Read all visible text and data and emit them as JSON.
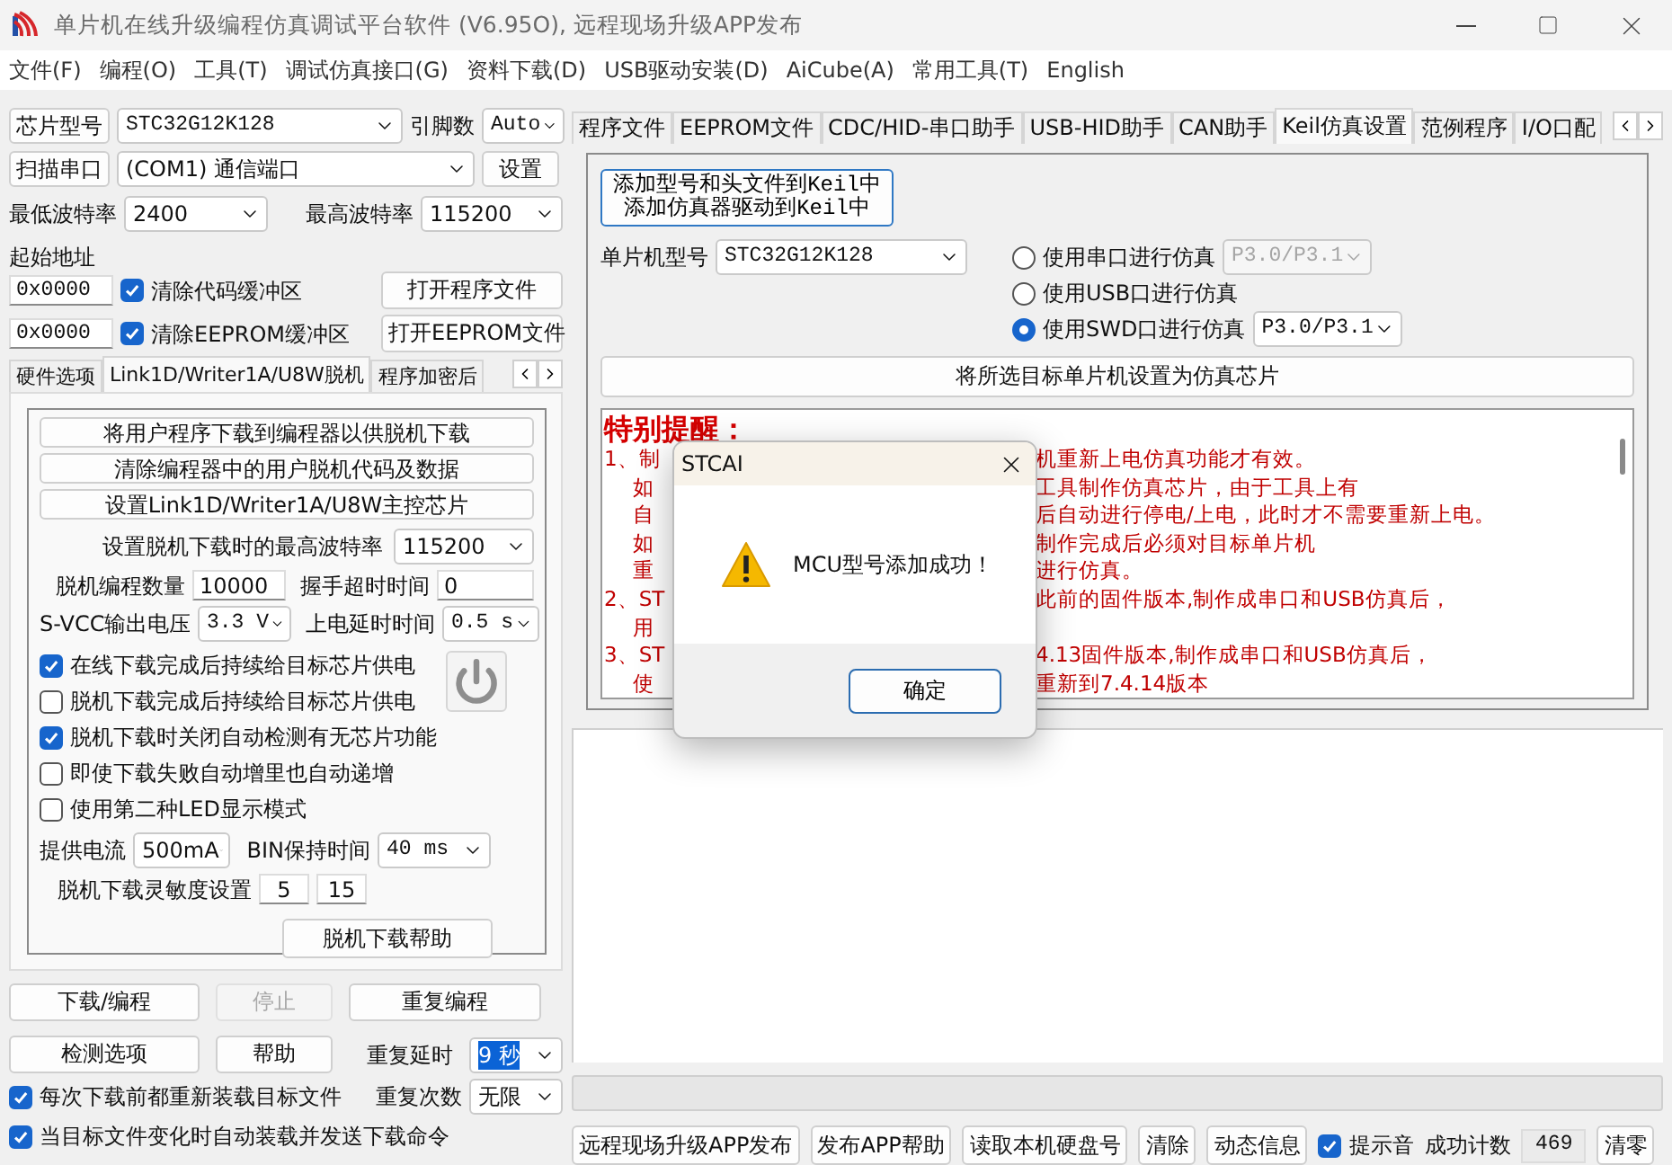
{
  "window": {
    "title": "单片机在线升级编程仿真调试平台软件 (V6.95O), 远程现场升级APP发布"
  },
  "menu": [
    "文件(F)",
    "编程(O)",
    "工具(T)",
    "调试仿真接口(G)",
    "资料下载(D)",
    "USB驱动安装(D)",
    "AiCube(A)",
    "常用工具(T)",
    "English"
  ],
  "chip": {
    "button": "芯片型号",
    "value": "STC32G12K128",
    "pins_label": "引脚数",
    "pins_value": "Auto"
  },
  "port": {
    "button": "扫描串口",
    "value": "(COM1) 通信端口",
    "settings": "设置"
  },
  "baud": {
    "min_label": "最低波特率",
    "min_value": "2400",
    "max_label": "最高波特率",
    "max_value": "115200"
  },
  "start_address": {
    "label": "起始地址",
    "rows": [
      {
        "value": "0x0000",
        "option": "清除代码缓冲区",
        "checked": true,
        "button": "打开程序文件"
      },
      {
        "value": "0x0000",
        "option": "清除EEPROM缓冲区",
        "checked": true,
        "button": "打开EEPROM文件"
      }
    ]
  },
  "left_tabs": [
    {
      "label": "硬件选项",
      "selected": false
    },
    {
      "label": "Link1D/Writer1A/U8W脱机",
      "selected": true
    },
    {
      "label": "程序加密后",
      "selected": false
    }
  ],
  "offline": {
    "actions": [
      "将用户程序下载到编程器以供脱机下载",
      "清除编程器中的用户脱机代码及数据",
      "设置Link1D/Writer1A/U8W主控芯片"
    ],
    "max_baud_label": "设置脱机下载时的最高波特率",
    "max_baud_value": "115200",
    "count_label": "脱机编程数量",
    "count_value": "10000",
    "handshake_label": "握手超时时间",
    "handshake_value": "0",
    "vcc_label": "S-VCC输出电压",
    "vcc_value": "3.3 V",
    "delay_label": "上电延时时间",
    "delay_value": "0.5 s",
    "options": [
      {
        "label": "在线下载完成后持续给目标芯片供电",
        "checked": true
      },
      {
        "label": "脱机下载完成后持续给目标芯片供电",
        "checked": false
      },
      {
        "label": "脱机下载时关闭自动检测有无芯片功能",
        "checked": true
      },
      {
        "label": "即使下载失败自动增里也自动递增",
        "checked": false
      },
      {
        "label": "使用第二种LED显示模式",
        "checked": false
      }
    ],
    "current_label": "提供电流",
    "current_value": "500mA",
    "bin_label": "BIN保持时间",
    "bin_value": "40 ms",
    "sensitivity_label": "脱机下载灵敏度设置",
    "sensitivity_values": [
      "5",
      "15"
    ],
    "help": "脱机下载帮助"
  },
  "actions": [
    {
      "label": "下载/编程",
      "disabled": false
    },
    {
      "label": "停止",
      "disabled": true
    },
    {
      "label": "重复编程",
      "disabled": false
    }
  ],
  "detect": "检测选项",
  "help": "帮助",
  "repeat_delay": {
    "label": "重复延时",
    "value": "9 秒",
    "highlighted": true
  },
  "repeat_count": {
    "label": "重复次数",
    "value": "无限"
  },
  "reload_options": [
    {
      "label": "每次下载前都重新装载目标文件",
      "checked": true
    },
    {
      "label": "当目标文件变化时自动装载并发送下载命令",
      "checked": true
    }
  ],
  "right_tabs": [
    {
      "label": "程序文件",
      "selected": false
    },
    {
      "label": "EEPROM文件",
      "selected": false
    },
    {
      "label": "CDC/HID-串口助手",
      "selected": false
    },
    {
      "label": "USB-HID助手",
      "selected": false
    },
    {
      "label": "CAN助手",
      "selected": false
    },
    {
      "label": "Keil仿真设置",
      "selected": true
    },
    {
      "label": "范例程序",
      "selected": false
    },
    {
      "label": "I/O口配",
      "selected": false
    }
  ],
  "keil": {
    "add_button": [
      "添加型号和头文件到Keil中",
      "添加仿真器驱动到Keil中"
    ],
    "mcu_label": "单片机型号",
    "mcu_value": "STC32G12K128",
    "modes": [
      {
        "label": "使用串口进行仿真",
        "selected": false,
        "port": "P3.0/P3.1",
        "port_disabled": true
      },
      {
        "label": "使用USB口进行仿真",
        "selected": false
      },
      {
        "label": "使用SWD口进行仿真",
        "selected": true,
        "port": "P3.0/P3.1",
        "port_disabled": false
      }
    ],
    "set_button": "将所选目标单片机设置为仿真芯片",
    "reminder_title": "特别提醒：",
    "reminder_lines": [
      {
        "kind": "item",
        "left": "1、制",
        "right": "机重新上电仿真功能才有效。"
      },
      {
        "kind": "continuation",
        "left": "如",
        "right": "工具制作仿真芯片，由于工具上有"
      },
      {
        "kind": "continuation",
        "left": "自",
        "right": "后自动进行停电/上电，此时才不需要重新上电。"
      },
      {
        "kind": "continuation",
        "left": "如",
        "right": "制作完成后必须对目标单片机"
      },
      {
        "kind": "continuation",
        "left": "重",
        "right": "进行仿真。"
      },
      {
        "kind": "item",
        "left": "2、ST",
        "right": "此前的固件版本,制作成串口和USB仿真后，"
      },
      {
        "kind": "continuation",
        "left": "用"
      },
      {
        "kind": "item",
        "left": "3、ST",
        "right": "4.13固件版本,制作成串口和USB仿真后，"
      },
      {
        "kind": "continuation",
        "left": "使",
        "right": "重新到7.4.14版本"
      }
    ]
  },
  "dialog": {
    "title": "STCAI",
    "message": "MCU型号添加成功！",
    "ok": "确定"
  },
  "progress": {
    "level": 0
  },
  "bottom": {
    "buttons": [
      "远程现场升级APP发布",
      "发布APP帮助",
      "读取本机硬盘号",
      "清除",
      "动态信息"
    ],
    "sound": {
      "label": "提示音",
      "checked": true
    },
    "count_label": "成功计数",
    "count_value": "469",
    "reset": "清零"
  }
}
